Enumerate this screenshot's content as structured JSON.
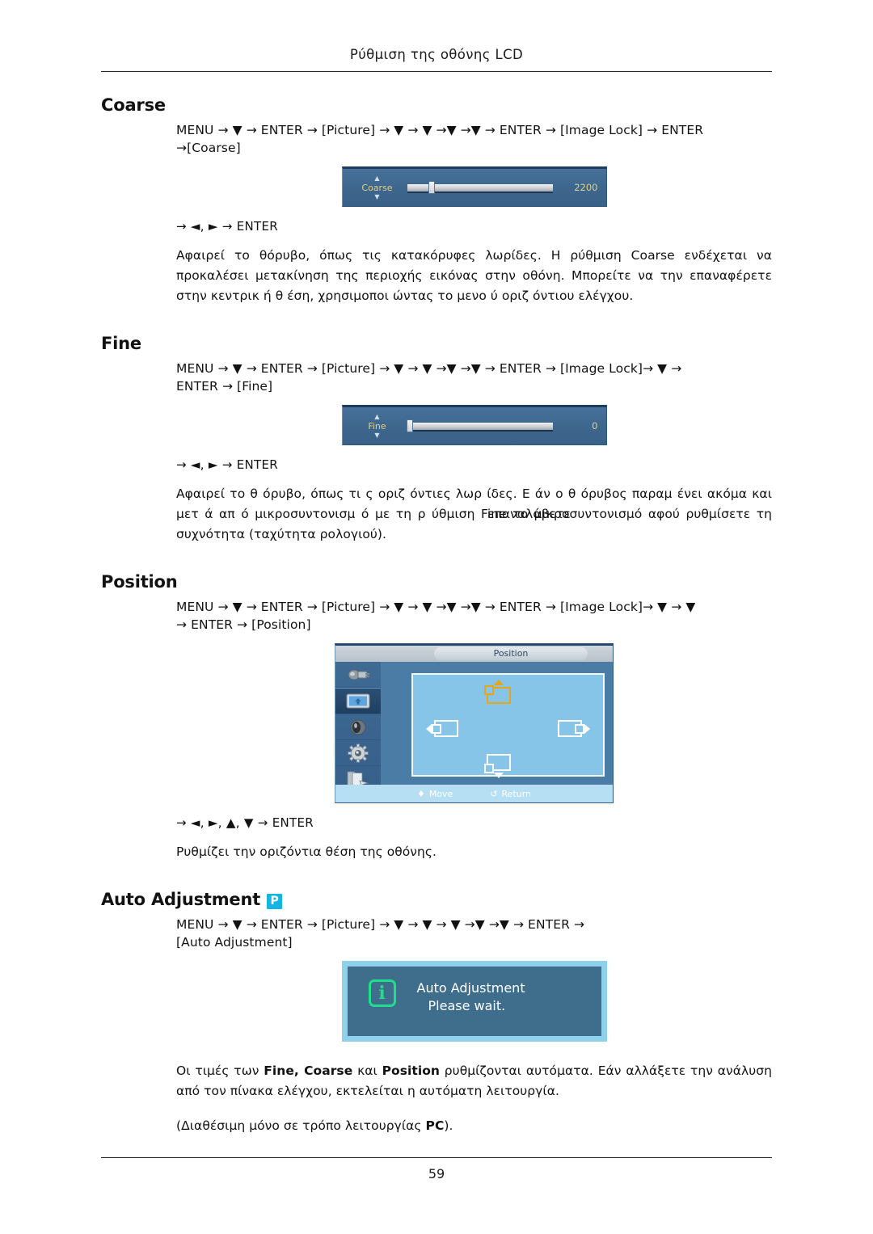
{
  "header": {
    "title": "Ρύθμιση της οθόνης LCD"
  },
  "footer": {
    "page_number": "59"
  },
  "sections": {
    "coarse": {
      "title": "Coarse",
      "menu_path_line1": "MENU → ▼ → ENTER → [Picture] → ▼ → ▼ →▼ →▼ → ENTER → [Image Lock] → ENTER",
      "menu_path_line2": "→[Coarse]",
      "key_line": "→ ◄, ► → ENTER",
      "body": "Αφαιρεί το θόρυβο, όπως τις κατακόρυφες λωρίδες. Η ρύθμιση Coarse ενδέχεται να προκαλέσει μετακίνηση της περιοχής εικόνας στην οθόνη. Μπορείτε να την επαναφέρετε στην κεντρικ ή θ έση, χρησιμοποι ώντας το μενο ύ οριζ όντιου ελέγχου.",
      "osd": {
        "label": "Coarse",
        "value": "2200",
        "thumb_percent": 17
      }
    },
    "fine": {
      "title": "Fine",
      "menu_path_line1": "MENU → ▼ → ENTER → [Picture] → ▼ → ▼ →▼ →▼ → ENTER → [Image Lock]→ ▼ →",
      "menu_path_line2": "ENTER → [Fine]",
      "key_line": "→ ◄, ► → ENTER",
      "body_part1": "Αφαιρεί το θ όρυβο, όπως τι ς οριζ όντιες λωρ ίδες. Ε άν ο θ όρυβος παραμ ένει ακόμα και μετ ά απ ό μικροσυντονισμ ό με τη ρ ύθμιση ",
      "body_overlap_a": "Fine",
      "body_overlap_b": "επαναλάβετε",
      "body_part2": " το μικροσυντονισμό αφού ρυθμίσετε τη συχνότητα (ταχύτητα ρολογιού).",
      "osd": {
        "label": "Fine",
        "value": "0",
        "thumb_percent": 0
      }
    },
    "position": {
      "title": "Position",
      "menu_path_line1": "MENU → ▼ → ENTER → [Picture] → ▼ → ▼ →▼ →▼ → ENTER → [Image Lock]→ ▼ → ▼",
      "menu_path_line2": "→ ENTER → [Position]",
      "key_line": "→ ◄, ►, ▲, ▼ → ENTER",
      "body": "Ρυθμίζει την οριζόντια θέση της οθόνης.",
      "osd": {
        "title": "Position",
        "sidebar_icons": [
          "input-source-icon",
          "picture-icon",
          "sound-icon",
          "setup-gear-icon",
          "multi-control-icon"
        ],
        "selected_sidebar_index": 1,
        "footer_move": "Move",
        "footer_return": "Return"
      }
    },
    "auto_adjustment": {
      "title": "Auto Adjustment",
      "badge": "P",
      "menu_path_line1": "MENU → ▼ → ENTER → [Picture] → ▼ → ▼ → ▼ →▼ →▼ → ENTER →",
      "menu_path_line2": "[Auto Adjustment]",
      "osd": {
        "line1": "Auto Adjustment",
        "line2": "Please wait.",
        "icon": "info-icon"
      },
      "body_1_pre": "Οι τιμές των ",
      "body_1_b1": "Fine, Coarse",
      "body_1_mid": " και ",
      "body_1_b2": "Position",
      "body_1_post": " ρυθμίζονται αυτόματα. Εάν αλλάξετε την ανάλυση από τον πίνακα ελέγχου, εκτελείται η αυτόματη λειτουργία.",
      "body_2_pre": "(Διαθέσιμη μόνο σε τρόπο λειτουργίας ",
      "body_2_b": "PC",
      "body_2_post": ")."
    }
  },
  "colors": {
    "osd_blue": "#4b7ca5",
    "osd_label_gold": "#ded08a",
    "badge_cyan": "#14b5e0",
    "info_green": "#1fdf8a",
    "stage_light_blue": "#86c5e8",
    "footer_blue": "#b7dff3"
  }
}
